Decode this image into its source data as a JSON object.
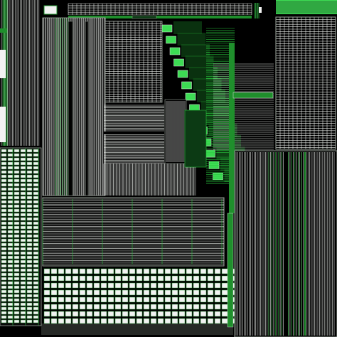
{
  "image": {
    "description_free": true,
    "palette": {
      "background": "#000000",
      "line_white": "#e8ece8",
      "line_gray": "#9aa39a",
      "line_green": "#29c43c",
      "fill_green": "#1f8f2c",
      "fill_bright_green": "#3ddc54",
      "fill_dark_green": "#0c3a14",
      "cell_white": "#f2f2f2"
    }
  }
}
